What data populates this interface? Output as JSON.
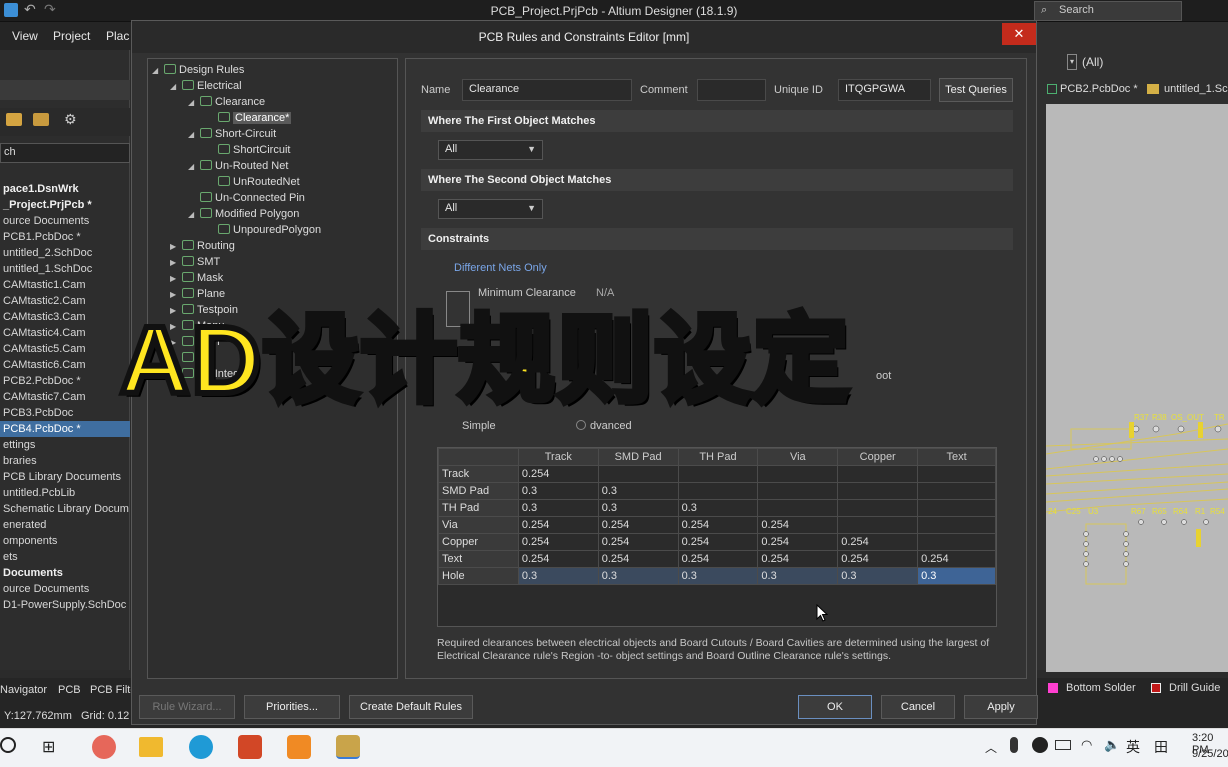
{
  "window": {
    "title": "PCB_Project.PrjPcb - Altium Designer (18.1.9)"
  },
  "search": {
    "placeholder": "Search"
  },
  "menu": [
    "View",
    "Project",
    "Plac"
  ],
  "project_panel": {
    "search_fragment": "ch",
    "items": [
      {
        "label": "pace1.DsnWrk",
        "bold": true
      },
      {
        "label": "_Project.PrjPcb *",
        "bold": true
      },
      {
        "label": "ource Documents"
      },
      {
        "label": "PCB1.PcbDoc *"
      },
      {
        "label": "untitled_2.SchDoc"
      },
      {
        "label": "untitled_1.SchDoc"
      },
      {
        "label": "CAMtastic1.Cam"
      },
      {
        "label": "CAMtastic2.Cam"
      },
      {
        "label": "CAMtastic3.Cam"
      },
      {
        "label": "CAMtastic4.Cam"
      },
      {
        "label": "CAMtastic5.Cam"
      },
      {
        "label": "CAMtastic6.Cam"
      },
      {
        "label": "PCB2.PcbDoc *"
      },
      {
        "label": "CAMtastic7.Cam"
      },
      {
        "label": "PCB3.PcbDoc"
      },
      {
        "label": "PCB4.PcbDoc *",
        "selected": true
      },
      {
        "label": "ettings"
      },
      {
        "label": "braries"
      },
      {
        "label": "PCB Library Documents"
      },
      {
        "label": "untitled.PcbLib"
      },
      {
        "label": "Schematic Library Docum"
      },
      {
        "label": "enerated"
      },
      {
        "label": "omponents"
      },
      {
        "label": "ets"
      },
      {
        "label": "Documents",
        "bold": true
      },
      {
        "label": "ource Documents"
      },
      {
        "label": "D1-PowerSupply.SchDoc"
      }
    ]
  },
  "dialog": {
    "title": "PCB Rules and Constraints Editor [mm]",
    "close": "✕",
    "tree": [
      {
        "label": "Design Rules",
        "level": 0,
        "arrow": "◢"
      },
      {
        "label": "Electrical",
        "level": 1,
        "arrow": "◢"
      },
      {
        "label": "Clearance",
        "level": 2,
        "arrow": "◢"
      },
      {
        "label": "Clearance*",
        "level": 3,
        "arrow": "",
        "selected": true
      },
      {
        "label": "Short-Circuit",
        "level": 2,
        "arrow": "◢"
      },
      {
        "label": "ShortCircuit",
        "level": 3,
        "arrow": ""
      },
      {
        "label": "Un-Routed Net",
        "level": 2,
        "arrow": "◢"
      },
      {
        "label": "UnRoutedNet",
        "level": 3,
        "arrow": ""
      },
      {
        "label": "Un-Connected Pin",
        "level": 2,
        "arrow": ""
      },
      {
        "label": "Modified Polygon",
        "level": 2,
        "arrow": "◢"
      },
      {
        "label": "UnpouredPolygon",
        "level": 3,
        "arrow": ""
      },
      {
        "label": "Routing",
        "level": 1,
        "arrow": "▶"
      },
      {
        "label": "SMT",
        "level": 1,
        "arrow": "▶"
      },
      {
        "label": "Mask",
        "level": 1,
        "arrow": "▶"
      },
      {
        "label": "Plane",
        "level": 1,
        "arrow": "▶"
      },
      {
        "label": "Testpoin",
        "level": 1,
        "arrow": "▶"
      },
      {
        "label": "Manu",
        "level": 1,
        "arrow": "▶"
      },
      {
        "label": "High",
        "level": 1,
        "arrow": "▶"
      },
      {
        "label": "nce",
        "level": 1,
        "arrow": "▶"
      },
      {
        "label": "nal Integrity",
        "level": 1,
        "arrow": ""
      }
    ],
    "name_label": "Name",
    "name_value": "Clearance",
    "comment_label": "Comment",
    "comment_value": "",
    "uid_label": "Unique ID",
    "uid_value": "ITQGPGWA",
    "test_queries": "Test Queries",
    "first_match": "Where The First Object Matches",
    "first_match_value": "All",
    "second_match": "Where The Second Object Matches",
    "second_match_value": "All",
    "constraints": "Constraints",
    "different_nets": "Different Nets Only",
    "min_clearance": "Minimum Clearance",
    "min_clearance_value": "N/A",
    "simple": "Simple",
    "advanced": "dvanced",
    "ignore_fragment": "oot",
    "matrix": {
      "columns": [
        "",
        "Track",
        "SMD Pad",
        "TH Pad",
        "Via",
        "Copper",
        "Text"
      ],
      "rows": [
        [
          "Track",
          "0.254",
          "",
          "",
          "",
          "",
          ""
        ],
        [
          "SMD Pad",
          "0.3",
          "0.3",
          "",
          "",
          "",
          ""
        ],
        [
          "TH Pad",
          "0.3",
          "0.3",
          "0.3",
          "",
          "",
          ""
        ],
        [
          "Via",
          "0.254",
          "0.254",
          "0.254",
          "0.254",
          "",
          ""
        ],
        [
          "Copper",
          "0.254",
          "0.254",
          "0.254",
          "0.254",
          "0.254",
          ""
        ],
        [
          "Text",
          "0.254",
          "0.254",
          "0.254",
          "0.254",
          "0.254",
          "0.254"
        ],
        [
          "Hole",
          "0.3",
          "0.3",
          "0.3",
          "0.3",
          "0.3",
          "0.3"
        ]
      ]
    },
    "note": "Required clearances between electrical objects and Board Cutouts / Board Cavities are determined using the largest of Electrical Clearance rule's Region -to- object settings and Board Outline Clearance rule's settings.",
    "buttons": {
      "rule_wizard": "Rule Wizard...",
      "priorities": "Priorities...",
      "create_default": "Create Default Rules",
      "ok": "OK",
      "cancel": "Cancel",
      "apply": "Apply"
    }
  },
  "overlay_text": "AD设计规则设定",
  "pcb": {
    "filter": "(All)",
    "tabs": [
      "PCB2.PcbDoc *",
      "untitled_1.Sc"
    ],
    "labels": [
      "R37",
      "R38",
      "OS_OUT",
      "TR",
      "24",
      "C25",
      "U3",
      "R67",
      "R65",
      "R64",
      "R1",
      "R54"
    ]
  },
  "bottom": {
    "tabs": [
      "Navigator",
      "PCB",
      "PCB Filte"
    ],
    "coords": "Y:127.762mm",
    "grid": "Grid: 0.12",
    "layers": [
      {
        "label": "Bottom Solder",
        "color": "#ff3fd0"
      },
      {
        "label": "Drill Guide",
        "color": "#c01818"
      }
    ]
  },
  "taskbar": {
    "lang": "英",
    "time": "3:20 PM",
    "date": "9/25/20"
  }
}
